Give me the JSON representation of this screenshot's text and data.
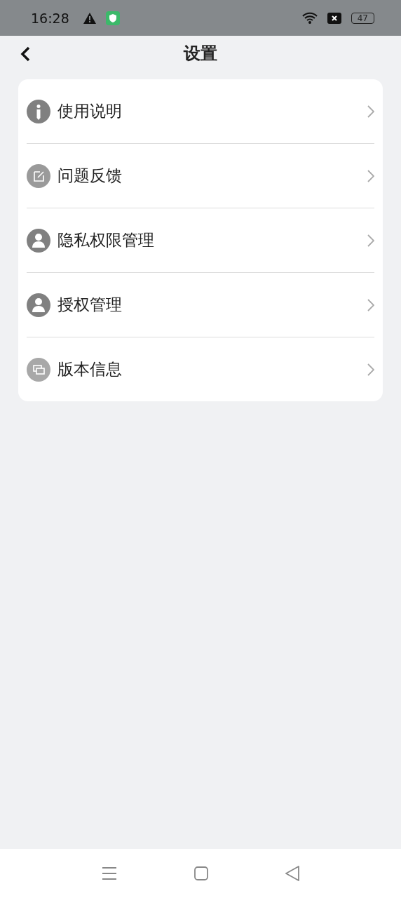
{
  "status_bar": {
    "time": "16:28",
    "battery": "47"
  },
  "header": {
    "title": "设置"
  },
  "menu": [
    {
      "label": "使用说明",
      "kind": "info"
    },
    {
      "label": "问题反馈",
      "kind": "edit"
    },
    {
      "label": "隐私权限管理",
      "kind": "person"
    },
    {
      "label": "授权管理",
      "kind": "person"
    },
    {
      "label": "版本信息",
      "kind": "windows"
    }
  ]
}
